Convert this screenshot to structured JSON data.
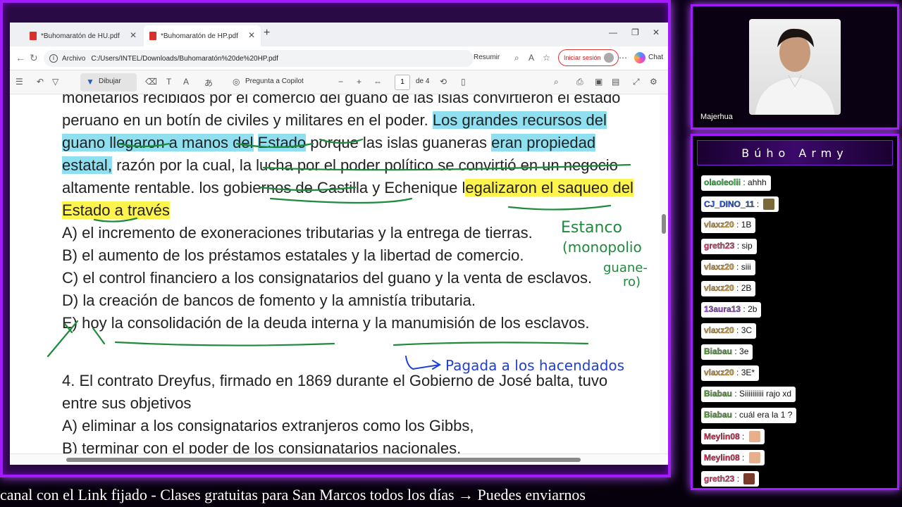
{
  "browser": {
    "tabs": [
      {
        "label": "*Buhomaratón de HU.pdf",
        "active": false
      },
      {
        "label": "*Buhomaratón de HP.pdf",
        "active": true
      }
    ],
    "address": {
      "prefix": "Archivo",
      "url": "C:/Users/INTEL/Downloads/Buhomaratón%20de%20HP.pdf",
      "resumir": "Resumir",
      "signin": "Iniciar sesión",
      "chat": "Chat"
    },
    "pdf_toolbar": {
      "draw": "Dibujar",
      "copilot": "Pregunta a Copilot",
      "page": "1",
      "page_total": "de 4"
    }
  },
  "document": {
    "lines": [
      "monetarios recibidos por el comercio del guano de las islas convirtieron el estado",
      "peruano en un botín de civiles y militares en el poder.",
      "Los grandes recursos del",
      "guano llegaron a manos del",
      "Estado",
      "porque las islas guaneras",
      "eran propiedad",
      "estatal,",
      "razón por la cual, la lucha por el poder político se convirtió en un negocio",
      "altamente rentable. los gobiernos de Castilla y Echenique l",
      "egalizaron el saqueo del",
      "Estado a través",
      "A) el incremento de exoneraciones tributarias y la entrega de tierras.",
      "B) el aumento de los préstamos estatales y la libertad de comercio.",
      "C) el control financiero a los consignatarios del guano y la venta de esclavos.",
      "D) la creación de bancos de fomento y la amnistía tributaria.",
      "E) hoy la consolidación de la deuda interna y la manumisión de los esclavos.",
      "4. El contrato Dreyfus, firmado en 1869 durante el Gobierno de José balta, tuvo",
      "entre sus objetivos",
      "A) eliminar a los consignatarios extranjeros como los Gibbs,",
      "B) terminar con el poder de los consignatarios nacionales."
    ],
    "handwriting": {
      "note1": [
        "Estanco",
        "(monopolio",
        "guane-",
        "ro)"
      ],
      "note2": "Pagada a los hacendados"
    }
  },
  "webcam": {
    "name": "Majerhua"
  },
  "chat": {
    "title": "Búho Army",
    "messages": [
      {
        "user": "olaoleolii",
        "text": "ahhh",
        "color": "#3cc34a"
      },
      {
        "user": "CJ_DINO_11",
        "text": "",
        "color": "#2a5bd7",
        "emote": "#7a6a3a"
      },
      {
        "user": "vlaxz20",
        "text": "1B",
        "color": "#d7a44a"
      },
      {
        "user": "greth23",
        "text": "sip",
        "color": "#d84b6f"
      },
      {
        "user": "vlaxz20",
        "text": "siii",
        "color": "#d7a44a"
      },
      {
        "user": "vlaxz20",
        "text": "2B",
        "color": "#d7a44a"
      },
      {
        "user": "13aura13",
        "text": "2b",
        "color": "#9b4fd0"
      },
      {
        "user": "vlaxz20",
        "text": "3C",
        "color": "#d7a44a"
      },
      {
        "user": "Biabau",
        "text": "3e",
        "color": "#5aa83c"
      },
      {
        "user": "vlaxz20",
        "text": "3E*",
        "color": "#d7a44a"
      },
      {
        "user": "Biabau",
        "text": "Siiiiiiiiii rajo xd",
        "color": "#5aa83c"
      },
      {
        "user": "Biabau",
        "text": "cuál era la 1 ?",
        "color": "#5aa83c"
      },
      {
        "user": "Meylin08",
        "text": "",
        "color": "#d23a5a",
        "emote": "#e8b08a"
      },
      {
        "user": "Meylin08",
        "text": "",
        "color": "#d23a5a",
        "emote": "#e8b08a"
      },
      {
        "user": "greth23",
        "text": "",
        "color": "#d84b6f",
        "emote": "#7a3a2a"
      }
    ]
  },
  "ticker": "canal con el Link fijado  -  Clases gratuitas para San Marcos todos los días  →  Puedes enviarnos"
}
